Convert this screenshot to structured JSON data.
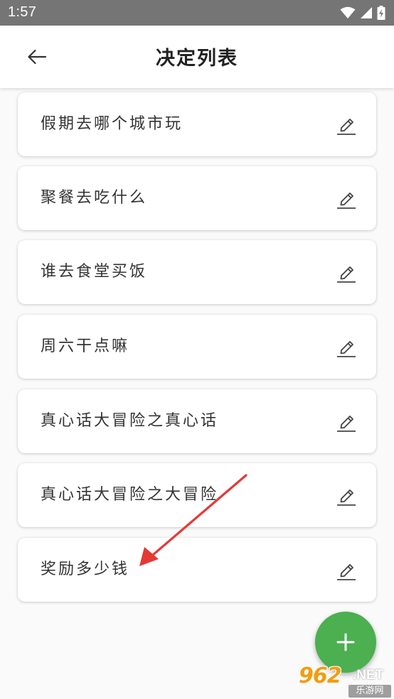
{
  "status_bar": {
    "time": "1:57",
    "icons": [
      "wifi-icon",
      "signal-icon",
      "battery-charging-icon"
    ]
  },
  "app_bar": {
    "title": "决定列表",
    "back_icon": "arrow-left-icon"
  },
  "decisions": [
    {
      "label": "假期去哪个城市玩"
    },
    {
      "label": "聚餐去吃什么"
    },
    {
      "label": "谁去食堂买饭"
    },
    {
      "label": "周六干点嘛"
    },
    {
      "label": "真心话大冒险之真心话"
    },
    {
      "label": "真心话大冒险之大冒险"
    },
    {
      "label": "奖励多少钱"
    }
  ],
  "edit_icon": "pencil-icon",
  "fab": {
    "icon": "plus-icon",
    "color": "#4caf50"
  },
  "annotation": {
    "color": "#e53935",
    "icon": "arrow-annotation"
  },
  "watermark": {
    "brand": "962",
    "domain": ".NET",
    "site": "乐游网"
  },
  "colors": {
    "status_bar": "#757575",
    "background": "#fafafa",
    "card": "#ffffff",
    "text": "#333333"
  }
}
